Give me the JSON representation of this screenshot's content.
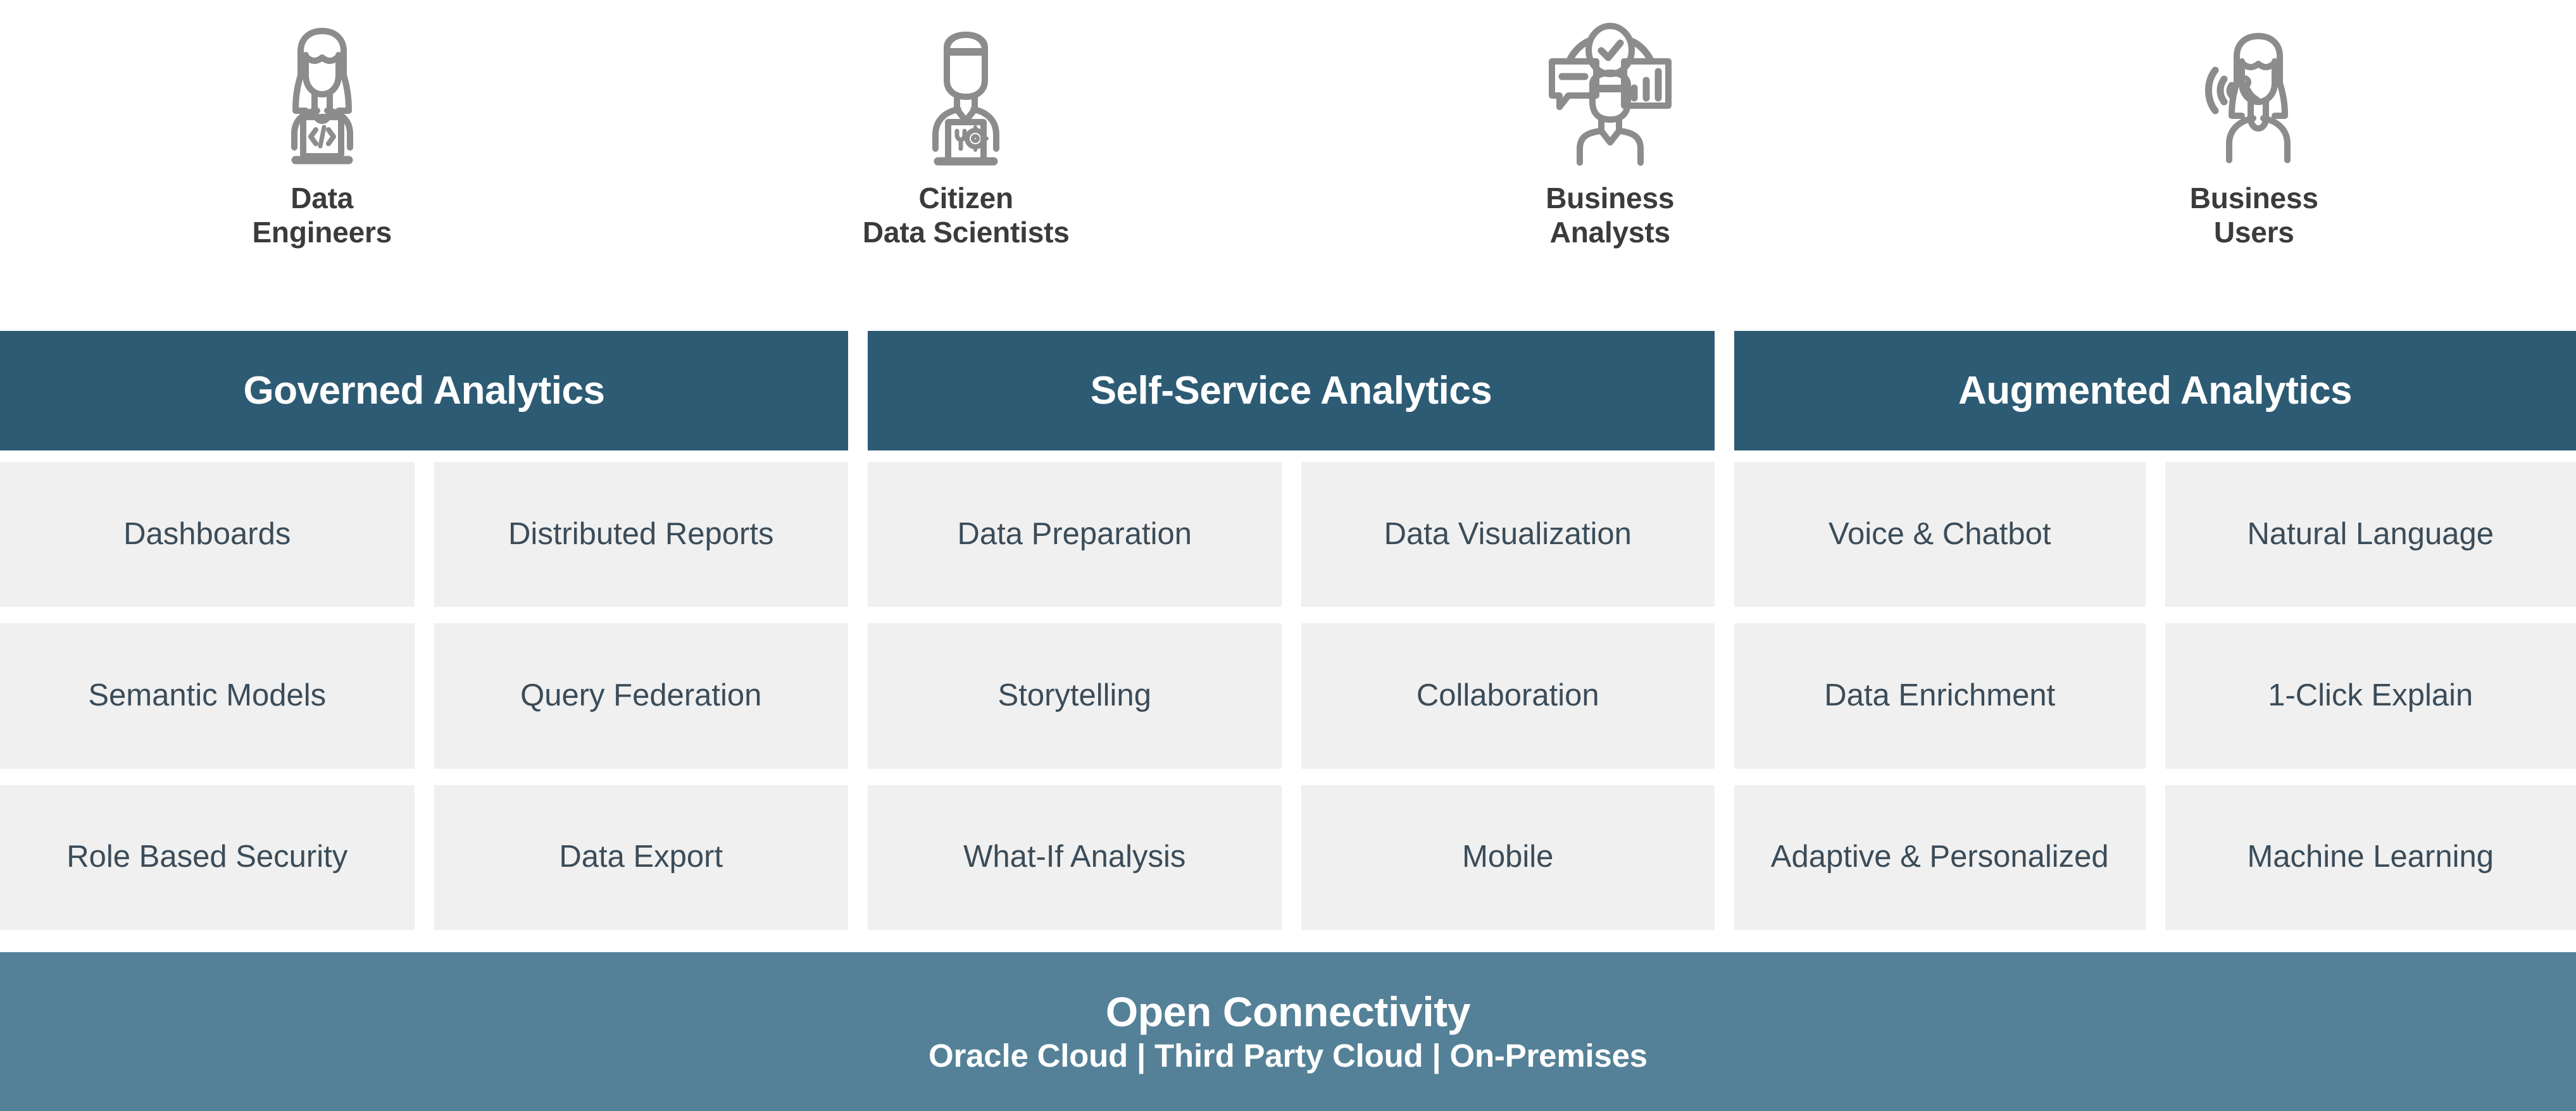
{
  "colors": {
    "header_teal": "#2D5B74",
    "footer_blue": "#548197",
    "tile_bg": "#F0F0F0",
    "tile_text": "#3B4C59",
    "icon_gray": "#8C8C8C",
    "persona_text": "#3B3B3B",
    "page_bg": "#FFFFFF"
  },
  "personas": [
    {
      "icon": "data-engineer-icon",
      "line1": "Data",
      "line2": "Engineers"
    },
    {
      "icon": "citizen-data-scientist-icon",
      "line1": "Citizen",
      "line2": "Data Scientists"
    },
    {
      "icon": "business-analyst-icon",
      "line1": "Business",
      "line2": "Analysts"
    },
    {
      "icon": "business-user-icon",
      "line1": "Business",
      "line2": "Users"
    }
  ],
  "groups": [
    {
      "title": "Governed Analytics",
      "rows": [
        [
          "Dashboards",
          "Distributed Reports"
        ],
        [
          "Semantic Models",
          "Query Federation"
        ],
        [
          "Role Based Security",
          "Data Export"
        ]
      ]
    },
    {
      "title": "Self-Service Analytics",
      "rows": [
        [
          "Data Preparation",
          "Data Visualization"
        ],
        [
          "Storytelling",
          "Collaboration"
        ],
        [
          "What-If Analysis",
          "Mobile"
        ]
      ]
    },
    {
      "title": "Augmented Analytics",
      "rows": [
        [
          "Voice & Chatbot",
          "Natural Language"
        ],
        [
          "Data Enrichment",
          "1-Click Explain"
        ],
        [
          "Adaptive & Personalized",
          "Machine Learning"
        ]
      ]
    }
  ],
  "footer": {
    "title": "Open Connectivity",
    "subtitle": "Oracle Cloud | Third Party Cloud | On-Premises"
  }
}
